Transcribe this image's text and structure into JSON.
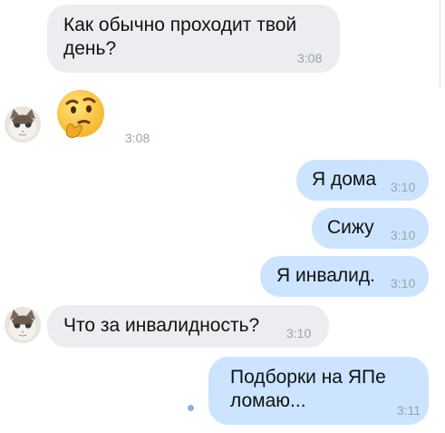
{
  "chat": {
    "messages": [
      {
        "author": "them",
        "text": "Как обычно проходит твой\nдень?",
        "time": "3:08"
      },
      {
        "author": "them",
        "emoji": "thinking-face",
        "time": "3:08"
      },
      {
        "author": "me",
        "text": "Я дома",
        "time": "3:10"
      },
      {
        "author": "me",
        "text": "Сижу",
        "time": "3:10"
      },
      {
        "author": "me",
        "text": "Я инвалид.",
        "time": "3:10"
      },
      {
        "author": "them",
        "text": "Что за инвалидность?",
        "time": "3:10"
      },
      {
        "author": "me",
        "text": "Подборки на ЯПе\nломаю...",
        "time": "3:11",
        "status": "unread"
      }
    ]
  },
  "colors": {
    "incoming_bubble": "#ebedf0",
    "outgoing_bubble": "#cce4ff",
    "timestamp": "#9aa3ad",
    "unread_dot": "#8fb1d9"
  }
}
